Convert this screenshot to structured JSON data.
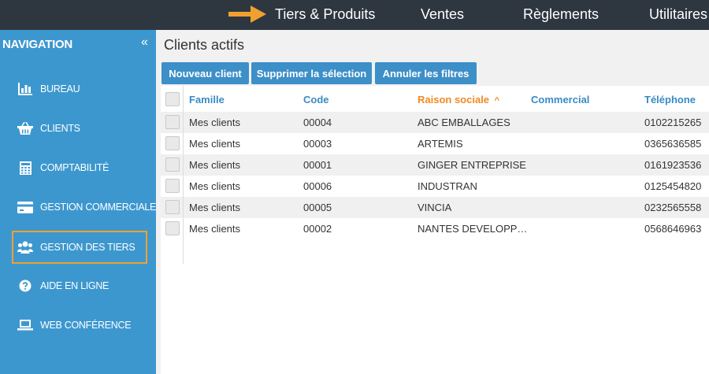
{
  "topnav": {
    "items": [
      {
        "label": "Tiers & Produits"
      },
      {
        "label": "Ventes"
      },
      {
        "label": "Règlements"
      },
      {
        "label": "Utilitaires"
      }
    ],
    "arrow_color": "#f0a030"
  },
  "sidebar": {
    "title": "NAVIGATION",
    "collapse_glyph": "«",
    "items": [
      {
        "label": "BUREAU",
        "icon": "bar-chart-icon"
      },
      {
        "label": "CLIENTS",
        "icon": "basket-icon"
      },
      {
        "label": "COMPTABILITÉ",
        "icon": "calculator-icon"
      },
      {
        "label": "GESTION COMMERCIALE",
        "icon": "credit-card-icon"
      },
      {
        "label": "GESTION DES TIERS",
        "icon": "users-icon",
        "highlighted": true
      },
      {
        "label": "AIDE EN LIGNE",
        "icon": "question-circle-icon"
      },
      {
        "label": "WEB CONFÉRENCE",
        "icon": "laptop-icon"
      }
    ],
    "highlight_color": "#f0a030"
  },
  "main": {
    "title": "Clients actifs",
    "buttons": {
      "new": "Nouveau client",
      "delete": "Supprimer la sélection",
      "reset": "Annuler les filtres"
    },
    "table": {
      "columns": [
        "Famille",
        "Code",
        "Raison sociale",
        "Commercial",
        "Téléphone"
      ],
      "sorted_column": "Raison sociale",
      "sort_indicator": "^",
      "rows": [
        [
          "Mes clients",
          "00004",
          "ABC EMBALLAGES",
          "",
          "0102215265"
        ],
        [
          "Mes clients",
          "00003",
          "ARTEMIS",
          "",
          "0365636585"
        ],
        [
          "Mes clients",
          "00001",
          "GINGER ENTREPRISE",
          "",
          "0161923536"
        ],
        [
          "Mes clients",
          "00006",
          "INDUSTRAN",
          "",
          "0125454820"
        ],
        [
          "Mes clients",
          "00005",
          "VINCIA",
          "",
          "0232565558"
        ],
        [
          "Mes clients",
          "00002",
          "NANTES DEVELOPP…",
          "",
          "0568646963"
        ]
      ]
    }
  },
  "colors": {
    "topbar": "#2e3640",
    "sidebar": "#3d97cf",
    "button": "#3d8fc8",
    "header_text": "#3a8bc5",
    "sorted_header": "#f08a24"
  }
}
